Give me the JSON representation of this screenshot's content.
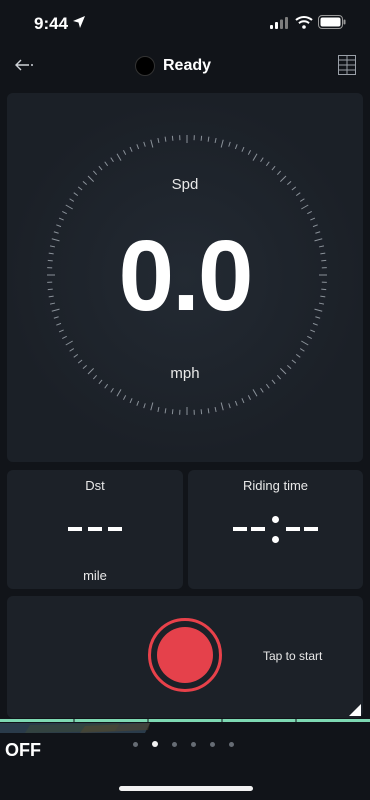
{
  "status_bar": {
    "time": "9:44",
    "icons": [
      "location-arrow-icon",
      "cellular-signal-icon",
      "wifi-icon",
      "battery-icon"
    ]
  },
  "header": {
    "back_icon": "back-arrow-icon",
    "state_label": "Ready",
    "layout_icon": "grid-layout-icon"
  },
  "speed": {
    "label": "Spd",
    "value": "0.0",
    "unit": "mph"
  },
  "distance": {
    "label": "Dst",
    "unit": "mile"
  },
  "riding_time": {
    "label": "Riding time"
  },
  "start": {
    "label": "Tap to start"
  },
  "footer": {
    "state": "OFF",
    "page_count": 6,
    "active_page": 2
  },
  "colors": {
    "background": "#111419",
    "card": "#1c2128",
    "record": "#e5414b",
    "accent_green": "#7ed9b3"
  }
}
